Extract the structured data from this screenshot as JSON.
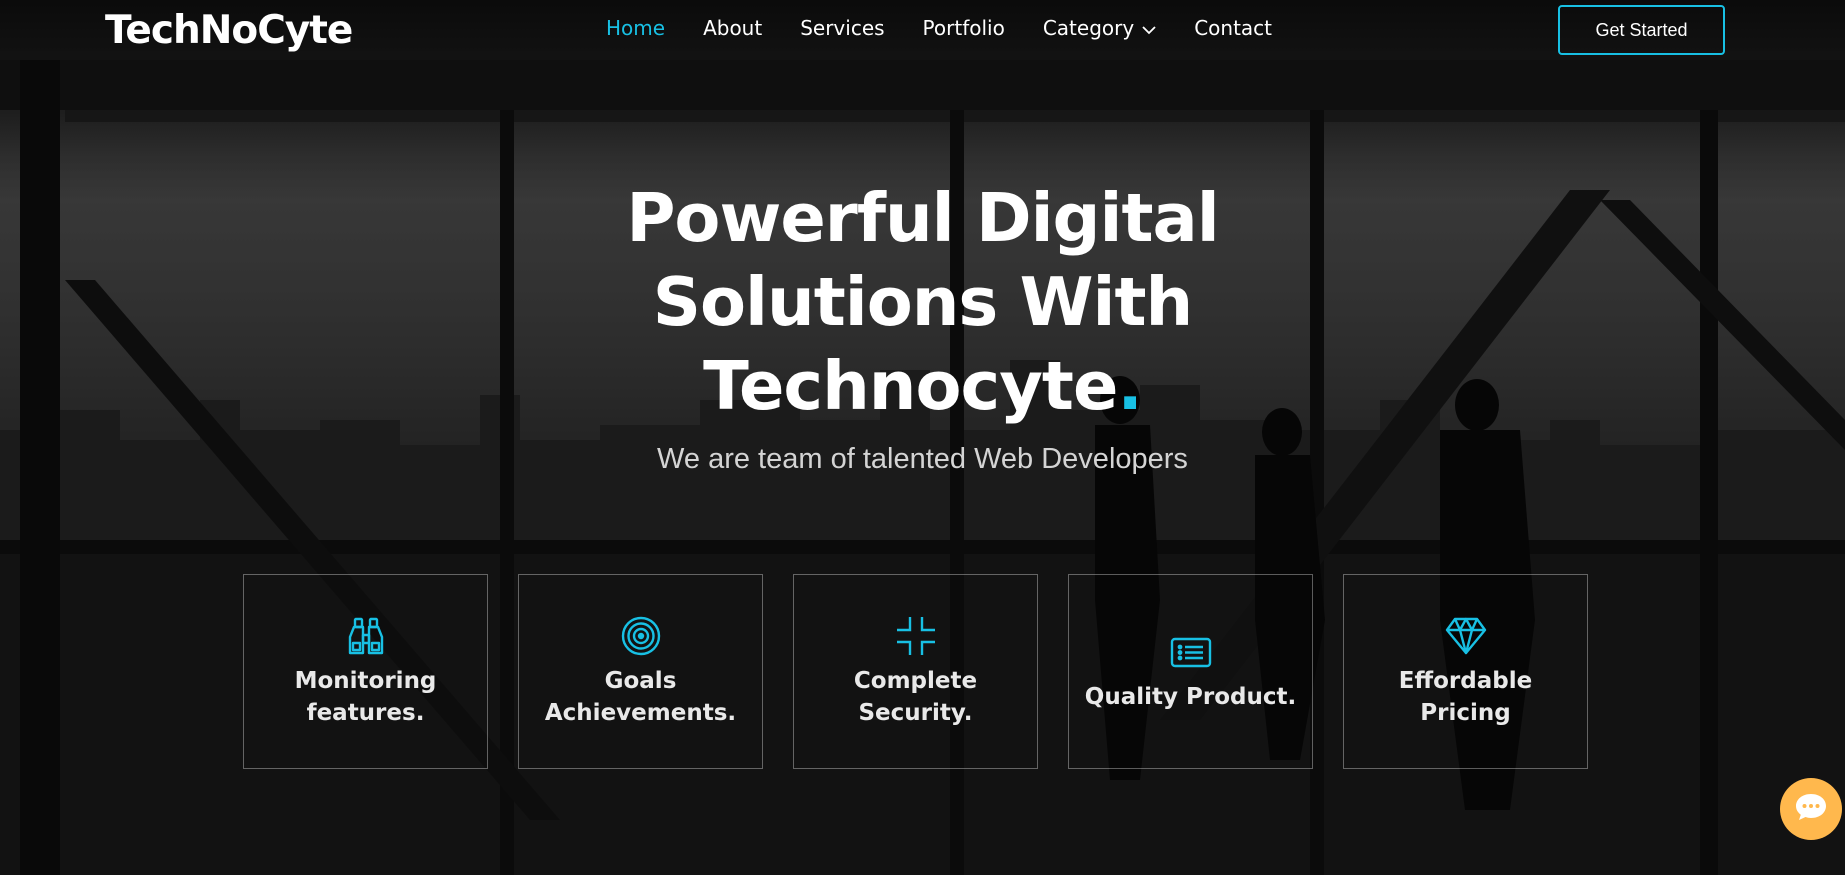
{
  "header": {
    "logo": "TechNoCyte",
    "nav": [
      {
        "label": "Home",
        "active": true
      },
      {
        "label": "About"
      },
      {
        "label": "Services"
      },
      {
        "label": "Portfolio"
      },
      {
        "label": "Category",
        "has_dropdown": true
      },
      {
        "label": "Contact"
      }
    ],
    "cta": "Get Started"
  },
  "hero": {
    "headline_line1": "Powerful Digital",
    "headline_line2": "Solutions With",
    "headline_line3": "Technocyte",
    "headline_dot": ".",
    "subheadline": "We are team of talented Web Developers"
  },
  "features": [
    {
      "icon": "binoculars-icon",
      "title": "Monitoring\nfeatures."
    },
    {
      "icon": "target-icon",
      "title": "Goals\nAchievements."
    },
    {
      "icon": "compress-icon",
      "title": "Complete\nSecurity."
    },
    {
      "icon": "list-card-icon",
      "title": "Quality Product."
    },
    {
      "icon": "diamond-icon",
      "title": "Effordable\nPricing"
    }
  ],
  "chat_widget": {
    "icon": "chat-bubble-icon"
  },
  "colors": {
    "accent": "#18c0e4",
    "chat": "#ffb84d",
    "text": "#ffffff"
  }
}
